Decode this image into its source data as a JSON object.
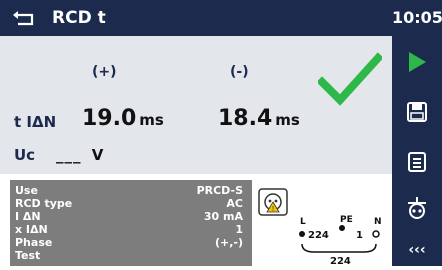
{
  "header": {
    "title": "RCD t",
    "clock": "10:05"
  },
  "results": {
    "polarity_pos": "(+)",
    "polarity_neg": "(-)",
    "t_label": "t IΔN",
    "t_pos_value": "19.0",
    "t_neg_value": "18.4",
    "unit": "ms",
    "uc_label": "Uc",
    "uc_value": "___",
    "uc_unit": "V"
  },
  "params": [
    {
      "key": "Use",
      "value": "PRCD-S"
    },
    {
      "key": "RCD type",
      "value": "AC"
    },
    {
      "key": "I ΔN",
      "value": "30 mA"
    },
    {
      "key": "x IΔN",
      "value": "1"
    },
    {
      "key": "Phase",
      "value": "(+,-)"
    },
    {
      "key": "Test",
      "value": ""
    }
  ],
  "diagram": {
    "l_label": "L",
    "pe_label": "PE",
    "n_label": "N",
    "left_value": "224",
    "right_value": "1",
    "bottom_value": "224"
  },
  "sidebar": {
    "more_label": "‹‹‹"
  },
  "colors": {
    "bar": "#1c2b4d",
    "accent_green": "#2eb84a",
    "panel": "#e3e6ea",
    "params_bg": "#7d7d7d"
  }
}
